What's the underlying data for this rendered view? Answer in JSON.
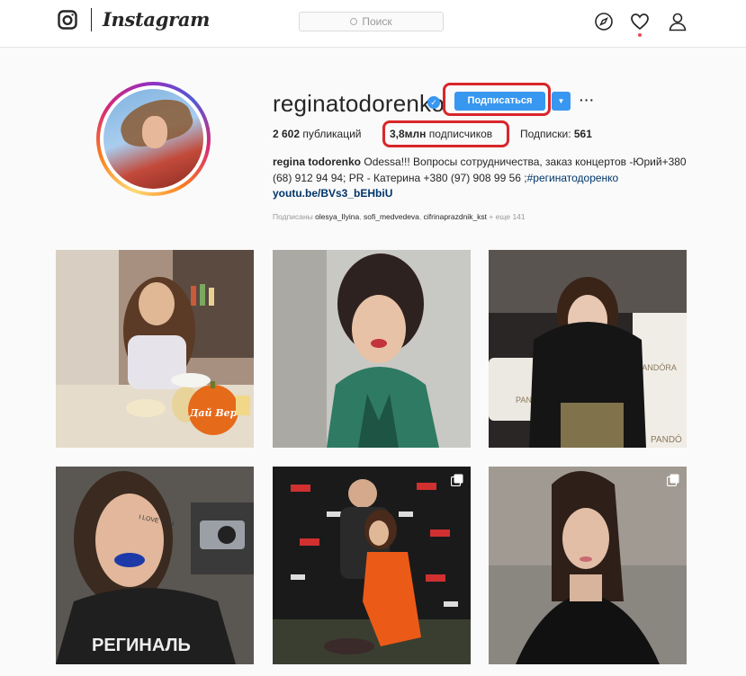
{
  "header": {
    "brand_wordmark": "Instagram",
    "search": {
      "placeholder": "Поиск"
    },
    "icons": [
      "instagram-glyph-icon",
      "explore-compass-icon",
      "activity-heart-icon",
      "profile-person-icon"
    ],
    "has_notification": true
  },
  "profile": {
    "username": "reginatodorenko",
    "verified": true,
    "follow_label": "Подписаться",
    "stats": {
      "posts_count": "2 602",
      "posts_label": "публикаций",
      "followers_count": "3,8млн",
      "followers_label": "подписчиков",
      "following_label": "Подписки:",
      "following_count": "561"
    },
    "bio": {
      "full_name": "regina todorenko",
      "line1": "Odessa!!! Вопросы сотрудничества, заказ концертов -Юрий+380",
      "line2a": "(68) 912 94 94; PR - Катерина +380 (97) 908 99 56 ;",
      "hashtag": "#регинатодоренко",
      "url": "youtu.be/BVs3_bEHbiU"
    },
    "followed_by": {
      "prefix": "Подписаны",
      "user1": "olesya_Ilyina",
      "user2": "sofi_medvedeva",
      "user3": "cifrinaprazdnik_kst",
      "suffix": "+ еще 141"
    }
  },
  "posts": [
    {
      "id": "post-1",
      "multi": false
    },
    {
      "id": "post-2",
      "multi": false
    },
    {
      "id": "post-3",
      "multi": false
    },
    {
      "id": "post-4",
      "multi": false
    },
    {
      "id": "post-5",
      "multi": true
    },
    {
      "id": "post-6",
      "multi": true
    }
  ],
  "post_text": {
    "pumpkin_label": "Дай Вер",
    "brand_sign": "PANDÓRA",
    "brand_sign_2": "PANDÓRA",
    "brand_sign_3": "PANDÓ",
    "shirt_text": "РЕГИНАЛЬ",
    "cheek_text": "I LOVE YOU"
  },
  "colors": {
    "accent_blue": "#3897f0",
    "highlight_red": "#d8262b",
    "link_navy": "#003569"
  }
}
